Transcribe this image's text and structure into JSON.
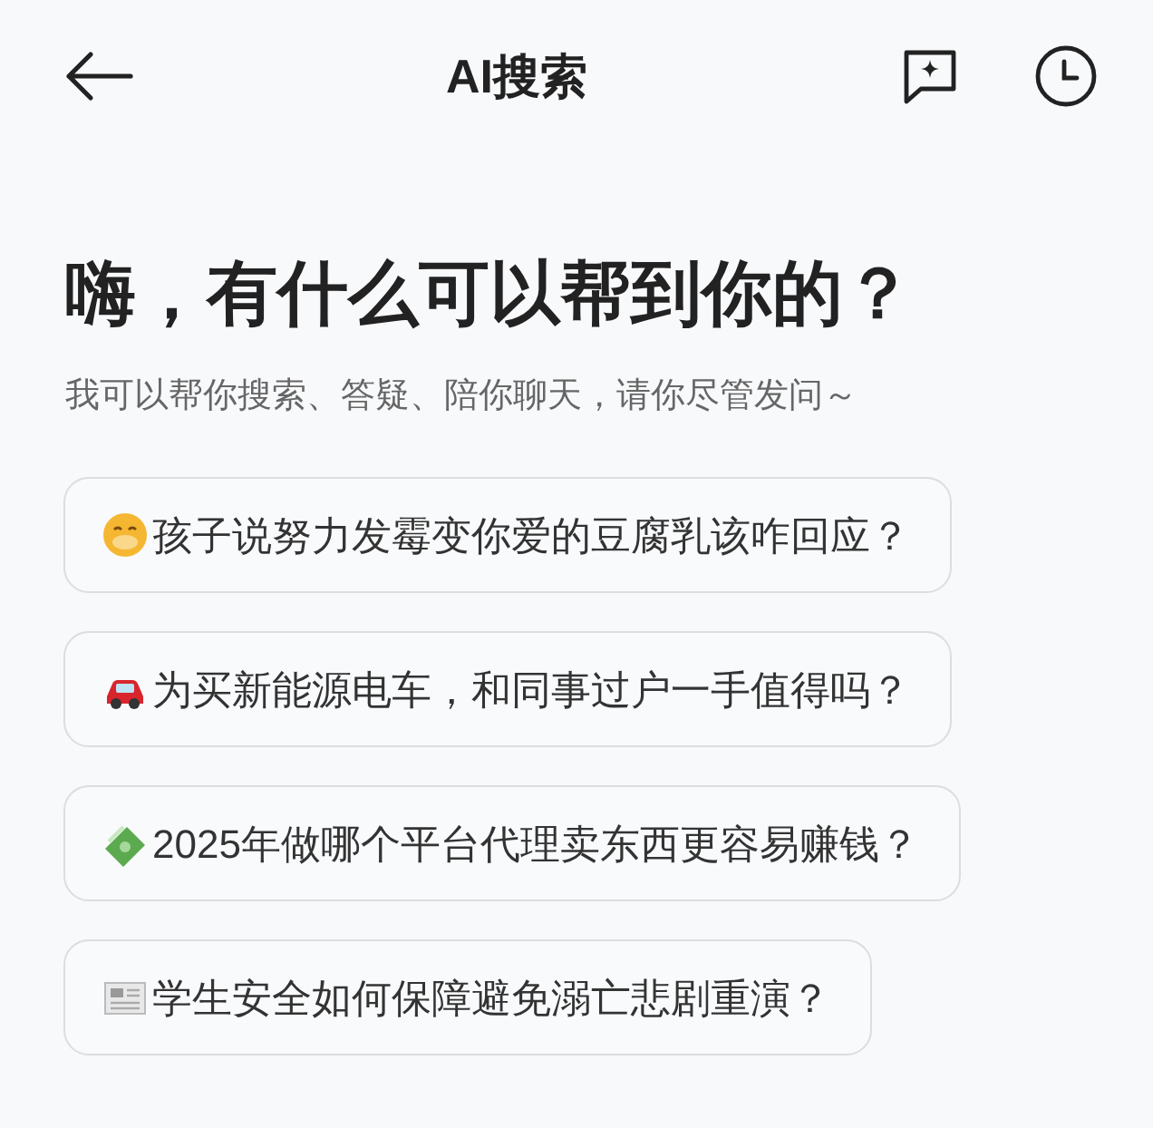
{
  "header": {
    "title": "AI搜索"
  },
  "greeting": {
    "heading": "嗨，有什么可以帮到你的？",
    "subtitle": "我可以帮你搜索、答疑、陪你聊天，请你尽管发问～"
  },
  "suggestions": [
    {
      "text": "孩子说努力发霉变你爱的豆腐乳该咋回应？"
    },
    {
      "text": "为买新能源电车，和同事过户一手值得吗？"
    },
    {
      "text": "2025年做哪个平台代理卖东西更容易赚钱？"
    },
    {
      "text": "学生安全如何保障避免溺亡悲剧重演？"
    }
  ]
}
